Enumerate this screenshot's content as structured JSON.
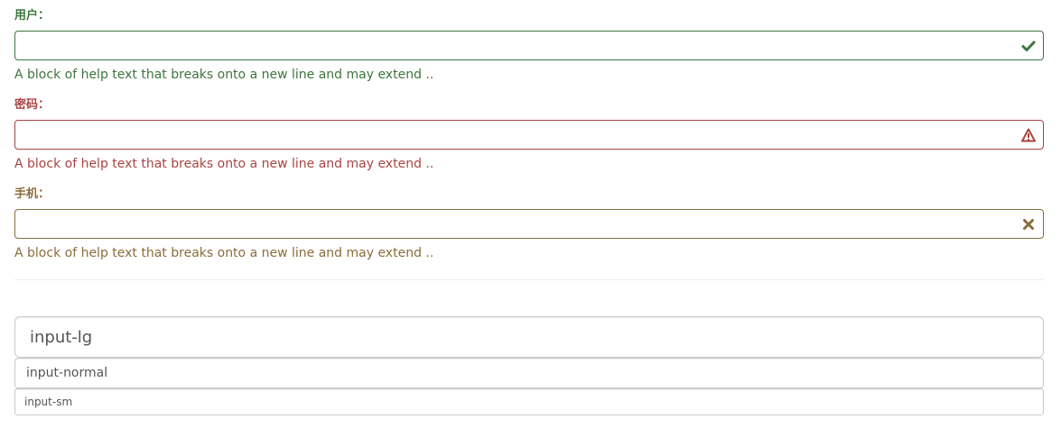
{
  "colors": {
    "success": "#3c763d",
    "error": "#a94442",
    "warning": "#8a6d3b",
    "default_border": "#cccccc",
    "divider": "#eeeeee"
  },
  "form": {
    "groups": [
      {
        "label": "用户：",
        "state": "success",
        "icon": "checkmark-icon",
        "value": "",
        "help": "A block of help text that breaks onto a new line and may extend .."
      },
      {
        "label": "密码：",
        "state": "error",
        "icon": "warning-triangle-icon",
        "value": "",
        "help": "A block of help text that breaks onto a new line and may extend .."
      },
      {
        "label": "手机：",
        "state": "warning",
        "icon": "close-x-icon",
        "value": "",
        "help": "A block of help text that breaks onto a new line and may extend .."
      }
    ]
  },
  "sizes": {
    "lg_placeholder": "input-lg",
    "normal_placeholder": "input-normal",
    "sm_placeholder": "input-sm"
  }
}
